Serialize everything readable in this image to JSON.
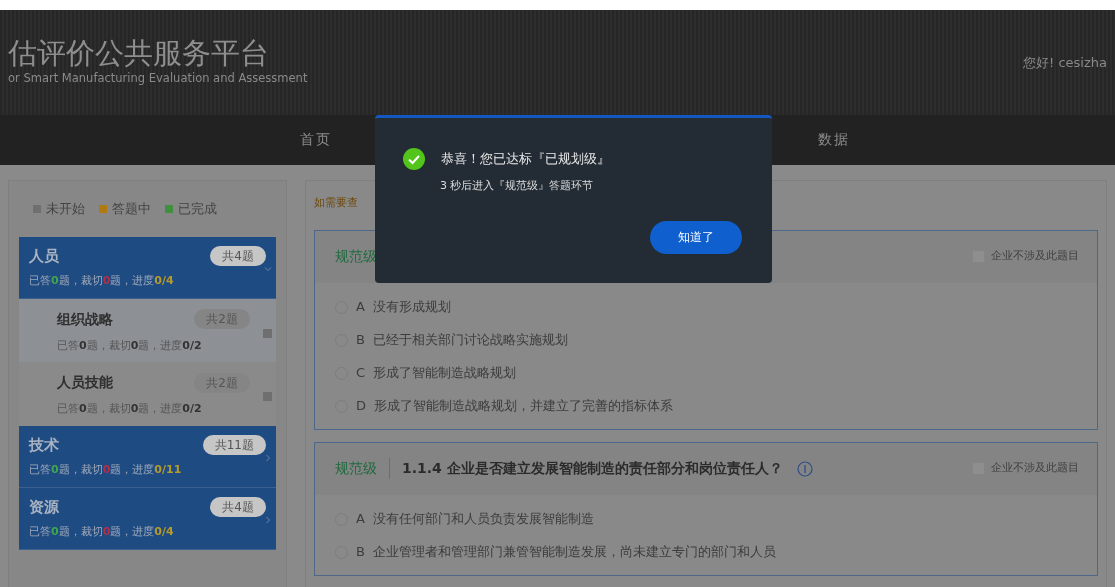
{
  "header": {
    "title": "估评价公共服务平台",
    "subtitle": "or Smart Manufacturing Evaluation and Assessment",
    "greeting": "您好! cesizha"
  },
  "nav": [
    {
      "label": "首页",
      "selected": false
    },
    {
      "label": "数据",
      "selected": false
    }
  ],
  "legend": [
    {
      "label": "未开始",
      "color": "#6f6f6f"
    },
    {
      "label": "答题中",
      "color": "#b07a12"
    },
    {
      "label": "已完成",
      "color": "#3f8f3f"
    }
  ],
  "sidebar": [
    {
      "name": "人员",
      "total": "共4题",
      "answered_label": "已答",
      "answered": "0",
      "cut_label": "题，裁切",
      "cut": "0",
      "progress_label": "题，进度",
      "progress": "0/4",
      "expanded": true,
      "children": [
        {
          "name": "组织战略",
          "total": "共2题",
          "answered_label": "已答",
          "answered": "0",
          "cut_label": "题，裁切",
          "cut": "0",
          "progress_label": "题，进度",
          "progress": "0/2",
          "selected": true,
          "color": "#6f6f6f"
        },
        {
          "name": "人员技能",
          "total": "共2题",
          "answered_label": "已答",
          "answered": "0",
          "cut_label": "题，裁切",
          "cut": "0",
          "progress_label": "题，进度",
          "progress": "0/2",
          "selected": false,
          "color": "#6f6f6f"
        }
      ]
    },
    {
      "name": "技术",
      "total": "共11题",
      "answered_label": "已答",
      "answered": "0",
      "cut_label": "题，裁切",
      "cut": "0",
      "progress_label": "题，进度",
      "progress": "0/11",
      "expanded": false
    },
    {
      "name": "资源",
      "total": "共4题",
      "answered_label": "已答",
      "answered": "0",
      "cut_label": "题，裁切",
      "cut": "0",
      "progress_label": "题，进度",
      "progress": "0/4",
      "expanded": false
    }
  ],
  "notice": "如需要查",
  "questions": [
    {
      "level": "规范级",
      "info": false,
      "skip_label": "企业不涉及此题目",
      "skip_checked": false,
      "options": [
        {
          "letter": "A",
          "text": "没有形成规划",
          "selected": false
        },
        {
          "letter": "B",
          "text": "已经于相关部门讨论战略实施规划",
          "selected": false
        },
        {
          "letter": "C",
          "text": "形成了智能制造战略规划",
          "selected": false
        },
        {
          "letter": "D",
          "text": "形成了智能制造战略规划，并建立了完善的指标体系",
          "selected": false
        }
      ]
    },
    {
      "level": "规范级",
      "title": "1.1.4 企业是否建立发展智能制造的责任部分和岗位责任人？",
      "info": true,
      "skip_label": "企业不涉及此题目",
      "skip_checked": false,
      "options": [
        {
          "letter": "A",
          "text": "没有任何部门和人员负责发展智能制造",
          "selected": false
        },
        {
          "letter": "B",
          "text": "企业管理者和管理部门兼管智能制造发展，尚未建立专门的部门和人员",
          "selected": false
        }
      ]
    }
  ],
  "dialog": {
    "title": "恭喜！您已达标『已规划级』",
    "message": "3 秒后进入『规范级』答题环节",
    "button": "知道了"
  }
}
